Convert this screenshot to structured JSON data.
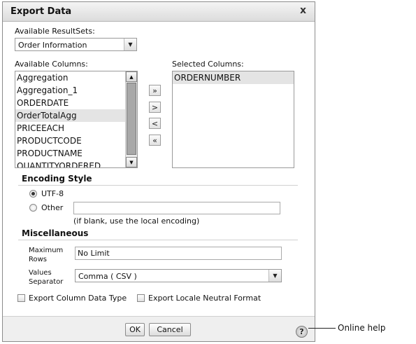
{
  "dialog": {
    "title": "Export Data",
    "close_label": "x",
    "available_resultsets_label": "Available ResultSets:",
    "resultset_selected": "Order Information",
    "available_columns_label": "Available Columns:",
    "available_columns": [
      "Aggregation",
      "Aggregation_1",
      "ORDERDATE",
      "OrderTotalAgg",
      "PRICEEACH",
      "PRODUCTCODE",
      "PRODUCTNAME",
      "QUANTITYORDERED"
    ],
    "available_columns_selected_index": 3,
    "selected_columns_label": "Selected Columns:",
    "selected_columns": [
      "ORDERNUMBER"
    ],
    "move_buttons": {
      "add_all": "»",
      "add": ">",
      "remove": "<",
      "remove_all": "«"
    },
    "encoding": {
      "section_title": "Encoding Style",
      "utf8_label": "UTF-8",
      "other_label": "Other",
      "other_value": "",
      "hint": "(if blank, use the local encoding)"
    },
    "misc": {
      "section_title": "Miscellaneous",
      "max_rows_label": "Maximum Rows",
      "max_rows_value": "No Limit",
      "values_separator_label": "Values Separator",
      "values_separator_value": "Comma ( CSV )"
    },
    "checkboxes": {
      "export_column_data_type": "Export Column Data Type",
      "export_locale_neutral": "Export Locale Neutral Format"
    },
    "footer": {
      "ok": "OK",
      "cancel": "Cancel",
      "help_glyph": "?"
    }
  },
  "callout": {
    "online_help": "Online help"
  }
}
